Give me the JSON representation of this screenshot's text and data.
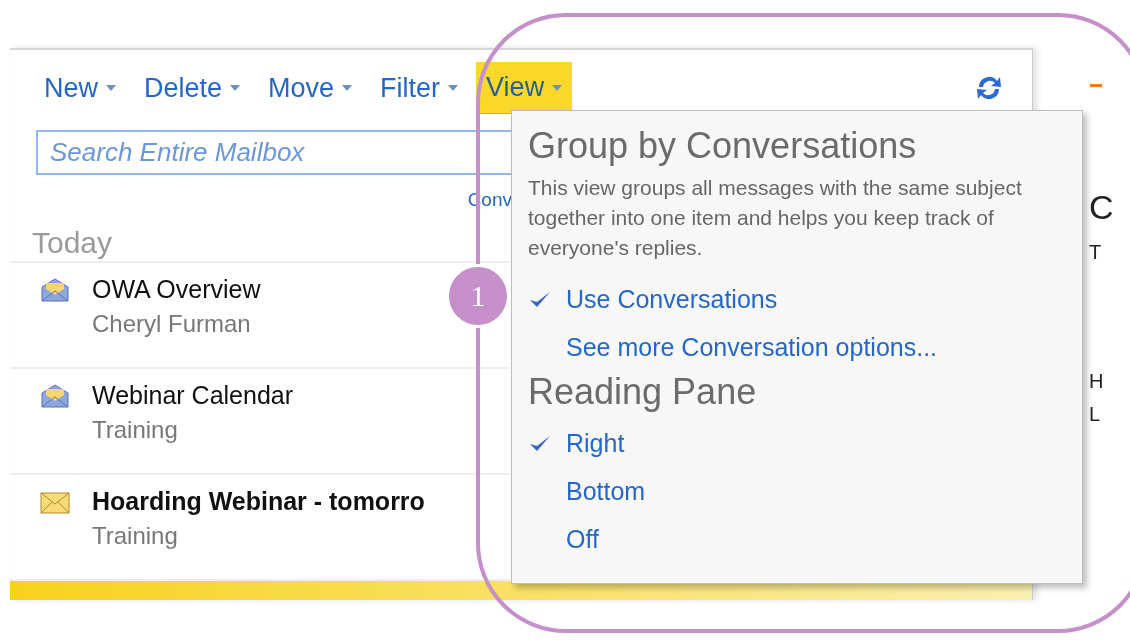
{
  "toolbar": {
    "buttons": [
      {
        "label": "New",
        "selected": false
      },
      {
        "label": "Delete",
        "selected": false
      },
      {
        "label": "Move",
        "selected": false
      },
      {
        "label": "Filter",
        "selected": false
      },
      {
        "label": "View",
        "selected": true
      }
    ]
  },
  "search": {
    "placeholder": "Search Entire Mailbox"
  },
  "conversation_link": "Conv",
  "group_header": "Today",
  "messages": [
    {
      "subject": "OWA Overview",
      "sender": "Cheryl Furman",
      "unread": false
    },
    {
      "subject": "Webinar Calendar",
      "sender": "Training",
      "unread": false
    },
    {
      "subject": "Hoarding Webinar - tomorro",
      "sender": "Training",
      "unread": true
    }
  ],
  "reading_pane": {
    "fragments": [
      {
        "text": "C",
        "kind": "heading"
      },
      {
        "text": "T",
        "kind": "text"
      },
      {
        "text": "H",
        "kind": "text"
      },
      {
        "text": "L",
        "kind": "text"
      }
    ]
  },
  "view_menu": {
    "sections": [
      {
        "title": "Group by Conversations",
        "description": "This view groups all messages with the same subject together into one item and helps you keep track of everyone's replies.",
        "options": [
          {
            "label": "Use Conversations",
            "checked": true
          },
          {
            "label": "See more Conversation options...",
            "checked": false
          }
        ]
      },
      {
        "title": "Reading Pane",
        "options": [
          {
            "label": "Right",
            "checked": true
          },
          {
            "label": "Bottom",
            "checked": false
          },
          {
            "label": "Off",
            "checked": false
          }
        ]
      }
    ]
  },
  "callout": {
    "number": "1"
  }
}
